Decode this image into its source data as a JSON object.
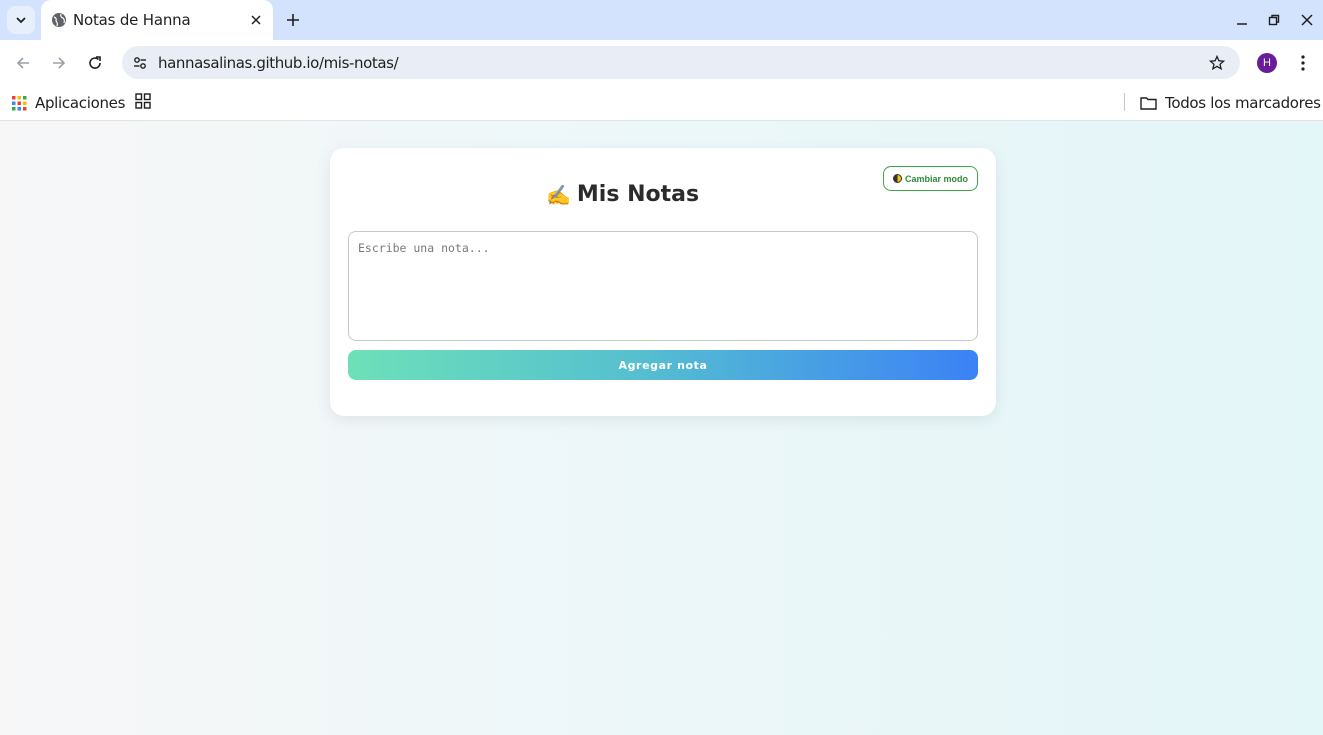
{
  "browser": {
    "tab": {
      "title": "Notas de Hanna",
      "favicon": "globe-icon"
    },
    "url": "hannasalinas.github.io/mis-notas/",
    "profile_initial": "H",
    "colors": {
      "tabstrip": "#d3e3fd",
      "omnibox": "#e9eef6",
      "avatar": "#6a1b9a"
    }
  },
  "bookmarks": {
    "apps_label": "Aplicaciones",
    "all_bookmarks_label": "Todos los marcadores"
  },
  "page": {
    "mode_button_label": "Cambiar modo",
    "title_emoji": "✍️",
    "title": "Mis Notas",
    "note_placeholder": "Escribe una nota...",
    "note_value": "",
    "add_button_label": "Agregar nota",
    "colors": {
      "accent_green": "#3ea64a",
      "button_gradient_start": "#6ee0b8",
      "button_gradient_end": "#3b82f6"
    }
  }
}
